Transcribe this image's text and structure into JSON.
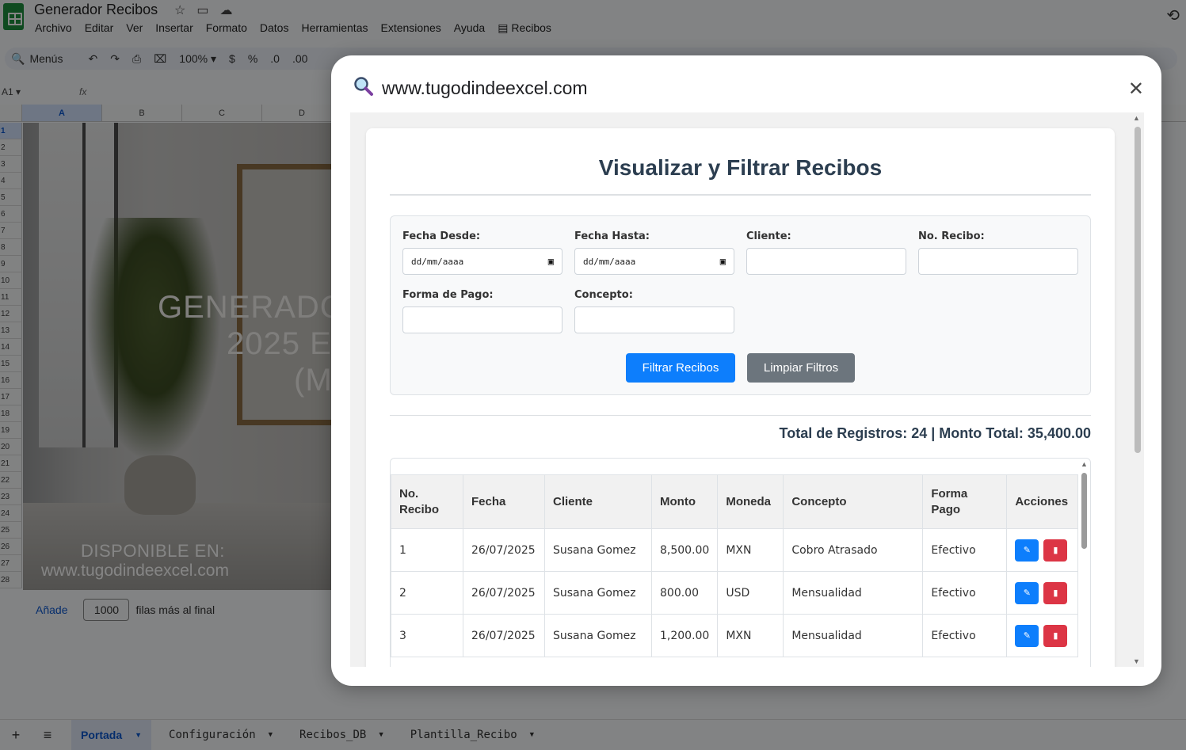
{
  "app": {
    "doc_title": "Generador Recibos",
    "menu": [
      "Archivo",
      "Editar",
      "Ver",
      "Insertar",
      "Formato",
      "Datos",
      "Herramientas",
      "Extensiones",
      "Ayuda",
      "Recibos"
    ]
  },
  "toolbar": {
    "search_label": "Menús",
    "zoom": "100%",
    "currency": "$",
    "percent": "%",
    "dec_dec": ".0",
    "dec_inc": ".00"
  },
  "formula_bar": {
    "cell_ref": "A1",
    "fx": "fx"
  },
  "columns": [
    "A",
    "B",
    "C",
    "D"
  ],
  "rows": [
    "1",
    "2",
    "3",
    "4",
    "5",
    "6",
    "7",
    "8",
    "9",
    "10",
    "11",
    "12",
    "13",
    "14",
    "15",
    "16",
    "17",
    "18",
    "19",
    "20",
    "21",
    "22",
    "23",
    "24",
    "25",
    "26",
    "27",
    "28"
  ],
  "cover": {
    "title_line1": "GENERADO",
    "title_line2": "2025 E",
    "title_line3": "(M",
    "available_label": "DISPONIBLE EN:",
    "url": "www.tugodindeexcel.com"
  },
  "add_rows": {
    "link": "Añade",
    "count": "1000",
    "suffix": "filas más al final"
  },
  "tabs": [
    {
      "label": "Portada",
      "active": true
    },
    {
      "label": "Configuración",
      "active": false
    },
    {
      "label": "Recibos_DB",
      "active": false
    },
    {
      "label": "Plantilla_Recibo",
      "active": false
    }
  ],
  "dialog": {
    "title": "www.tugodindeexcel.com",
    "heading": "Visualizar y Filtrar Recibos",
    "filters": {
      "fecha_desde": {
        "label": "Fecha Desde:",
        "placeholder": "dd/mm/aaaa"
      },
      "fecha_hasta": {
        "label": "Fecha Hasta:",
        "placeholder": "dd/mm/aaaa"
      },
      "cliente": {
        "label": "Cliente:",
        "value": ""
      },
      "no_recibo": {
        "label": "No. Recibo:",
        "value": ""
      },
      "forma_pago": {
        "label": "Forma de Pago:",
        "value": ""
      },
      "concepto": {
        "label": "Concepto:",
        "value": ""
      }
    },
    "filter_button": "Filtrar Recibos",
    "clear_button": "Limpiar Filtros",
    "summary": "Total de Registros: 24 | Monto Total: 35,400.00",
    "table": {
      "headers": [
        "No. Recibo",
        "Fecha",
        "Cliente",
        "Monto",
        "Moneda",
        "Concepto",
        "Forma Pago",
        "Acciones"
      ],
      "rows": [
        [
          "1",
          "26/07/2025",
          "Susana Gomez",
          "8,500.00",
          "MXN",
          "Cobro Atrasado",
          "Efectivo"
        ],
        [
          "2",
          "26/07/2025",
          "Susana Gomez",
          "800.00",
          "USD",
          "Mensualidad",
          "Efectivo"
        ],
        [
          "3",
          "26/07/2025",
          "Susana Gomez",
          "1,200.00",
          "MXN",
          "Mensualidad",
          "Efectivo"
        ]
      ]
    }
  },
  "colors": {
    "primary": "#0d7efc",
    "secondary": "#6c757d",
    "danger": "#dc3545",
    "heading": "#2c3e50"
  }
}
